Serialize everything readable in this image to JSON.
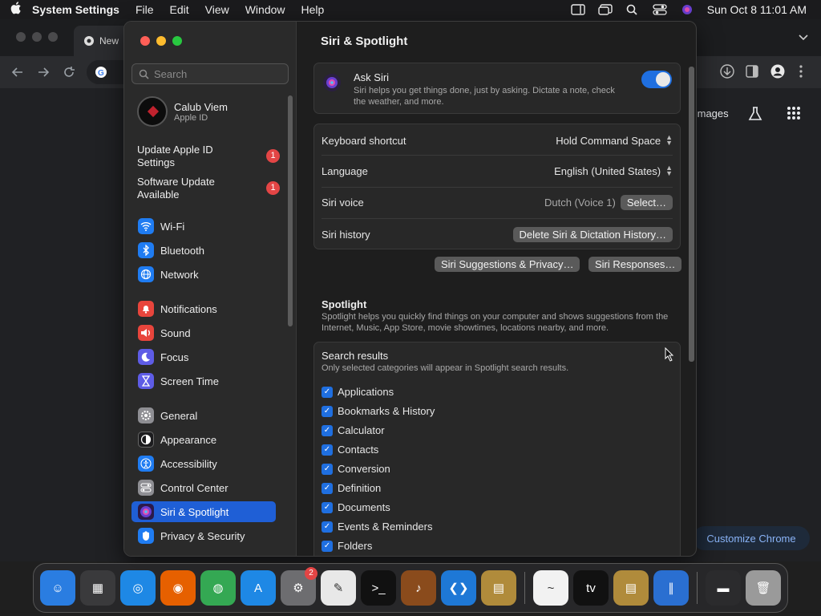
{
  "menubar": {
    "app_name": "System Settings",
    "menus": [
      "File",
      "Edit",
      "View",
      "Window",
      "Help"
    ],
    "datetime": "Sun Oct 8  11:01 AM"
  },
  "chrome": {
    "tab_title": "New",
    "images_link": "Images",
    "customize_button": "Customize Chrome"
  },
  "sidebar": {
    "search_placeholder": "Search",
    "account": {
      "name": "Calub Viem",
      "subtitle": "Apple ID"
    },
    "notices": [
      {
        "label": "Update Apple ID Settings",
        "badge": "1"
      },
      {
        "label": "Software Update Available",
        "badge": "1"
      }
    ],
    "items": [
      {
        "label": "Wi-Fi",
        "icon": "wifi-icon",
        "color": "#1f7cf2"
      },
      {
        "label": "Bluetooth",
        "icon": "bluetooth-icon",
        "color": "#1f7cf2"
      },
      {
        "label": "Network",
        "icon": "network-icon",
        "color": "#1f7cf2"
      },
      {
        "label": "Notifications",
        "icon": "notifications-icon",
        "color": "#e8453c"
      },
      {
        "label": "Sound",
        "icon": "sound-icon",
        "color": "#e8453c"
      },
      {
        "label": "Focus",
        "icon": "focus-icon",
        "color": "#5e5ce6"
      },
      {
        "label": "Screen Time",
        "icon": "screen-time-icon",
        "color": "#5e5ce6"
      },
      {
        "label": "General",
        "icon": "general-icon",
        "color": "#8e8e93"
      },
      {
        "label": "Appearance",
        "icon": "appearance-icon",
        "color": "#1c1c1e"
      },
      {
        "label": "Accessibility",
        "icon": "accessibility-icon",
        "color": "#1f7cf2"
      },
      {
        "label": "Control Center",
        "icon": "control-center-icon",
        "color": "#8e8e93"
      },
      {
        "label": "Siri & Spotlight",
        "icon": "siri-icon",
        "color": "#7a3fd1",
        "selected": true
      },
      {
        "label": "Privacy & Security",
        "icon": "privacy-icon",
        "color": "#1f7cf2"
      }
    ]
  },
  "main": {
    "title": "Siri & Spotlight",
    "ask_siri": {
      "label": "Ask Siri",
      "description": "Siri helps you get things done, just by asking. Dictate a note, check the weather, and more.",
      "enabled": true
    },
    "rows": {
      "keyboard_shortcut": {
        "label": "Keyboard shortcut",
        "value": "Hold Command Space"
      },
      "language": {
        "label": "Language",
        "value": "English (United States)"
      },
      "siri_voice": {
        "label": "Siri voice",
        "value": "Dutch (Voice 1)",
        "button": "Select…"
      },
      "siri_history": {
        "label": "Siri history",
        "button": "Delete Siri & Dictation History…"
      }
    },
    "buttons": {
      "suggestions": "Siri Suggestions & Privacy…",
      "responses": "Siri Responses…"
    },
    "spotlight": {
      "heading": "Spotlight",
      "description": "Spotlight helps you quickly find things on your computer and shows suggestions from the Internet, Music, App Store, movie showtimes, locations nearby, and more."
    },
    "search_results": {
      "heading": "Search results",
      "subtitle": "Only selected categories will appear in Spotlight search results.",
      "categories": [
        "Applications",
        "Bookmarks & History",
        "Calculator",
        "Contacts",
        "Conversion",
        "Definition",
        "Documents",
        "Events & Reminders",
        "Folders"
      ]
    }
  },
  "dock": {
    "apps": [
      {
        "name": "finder-icon",
        "color": "#2a7de1",
        "glyph": "☺"
      },
      {
        "name": "launchpad-icon",
        "color": "#3a3a3c",
        "glyph": "▦"
      },
      {
        "name": "safari-icon",
        "color": "#1e88e5",
        "glyph": "◎"
      },
      {
        "name": "firefox-icon",
        "color": "#e66000",
        "glyph": "◉"
      },
      {
        "name": "chrome-icon",
        "color": "#34a853",
        "glyph": "◍"
      },
      {
        "name": "app-store-icon",
        "color": "#1e88e5",
        "glyph": "A"
      },
      {
        "name": "system-settings-icon",
        "color": "#6d6d70",
        "glyph": "⚙",
        "badge": "2"
      },
      {
        "name": "textedit-icon",
        "color": "#e8e8e8",
        "glyph": "✎"
      },
      {
        "name": "terminal-icon",
        "color": "#111111",
        "glyph": ">_"
      },
      {
        "name": "garageband-icon",
        "color": "#8a4b1c",
        "glyph": "♪"
      },
      {
        "name": "vscode-icon",
        "color": "#1e78d6",
        "glyph": "❮❯"
      },
      {
        "name": "archive-utility-icon",
        "color": "#b08b3b",
        "glyph": "▤"
      },
      {
        "name": "freeform-icon",
        "color": "#f2f2f2",
        "glyph": "~"
      },
      {
        "name": "apple-tv-icon",
        "color": "#111111",
        "glyph": "tv"
      },
      {
        "name": "archive-icon",
        "color": "#b08b3b",
        "glyph": "▤"
      },
      {
        "name": "parallels-icon",
        "color": "#2a6fd1",
        "glyph": "∥"
      },
      {
        "name": "minimized-window-icon",
        "color": "#2b2b2d",
        "glyph": "▬"
      },
      {
        "name": "trash-icon",
        "color": "#9a9a9a",
        "glyph": "🗑"
      }
    ]
  }
}
